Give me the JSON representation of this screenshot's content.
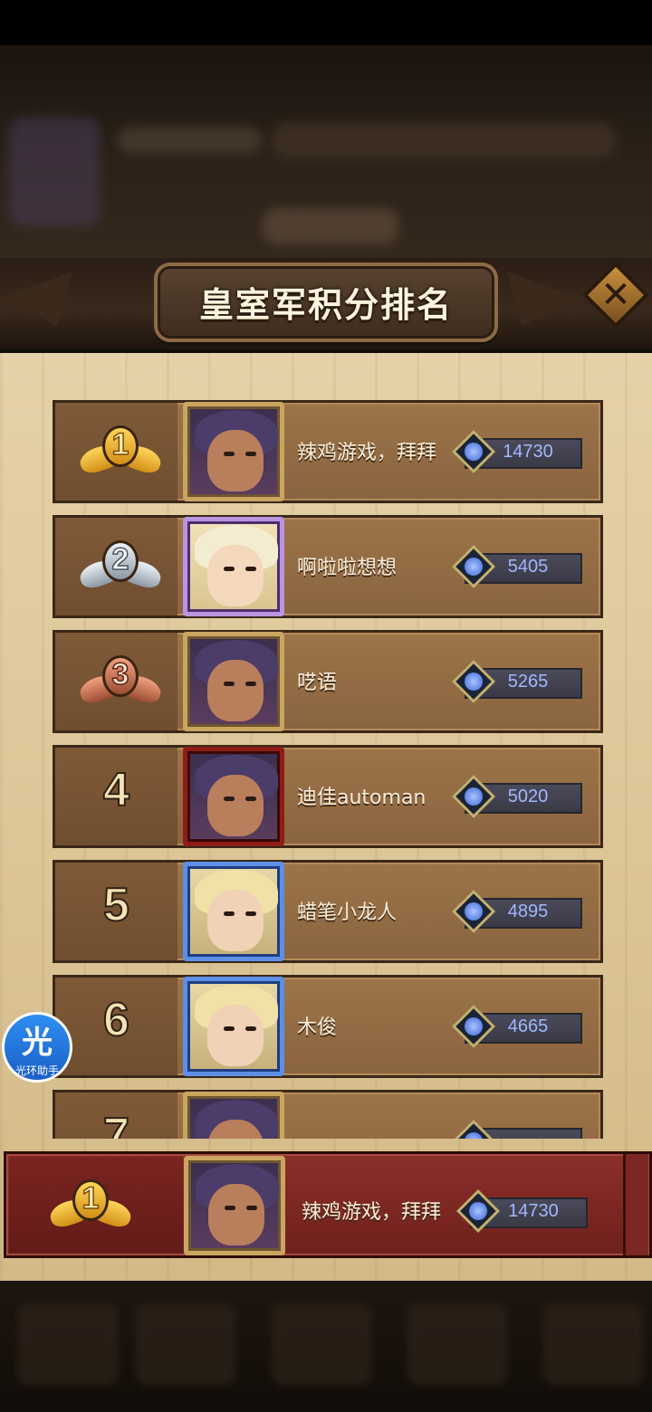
{
  "title": "皇室军积分排名",
  "colors": {
    "panel": "#dcc597",
    "row": "#8a6440",
    "highlight_bar": "#7a2420",
    "score_text": "#9fb8ff"
  },
  "close_icon": "close-x-icon",
  "rankings": [
    {
      "rank": "1",
      "medal": "gold",
      "name": "辣鸡游戏，拜拜",
      "score": "14730",
      "frame": "gold"
    },
    {
      "rank": "2",
      "medal": "silver",
      "name": "啊啦啦想想",
      "score": "5405",
      "frame": "purple"
    },
    {
      "rank": "3",
      "medal": "bronze",
      "name": "呓语",
      "score": "5265",
      "frame": "gold"
    },
    {
      "rank": "4",
      "medal": "",
      "name": "迪佳automan",
      "score": "5020",
      "frame": "red"
    },
    {
      "rank": "5",
      "medal": "",
      "name": "蜡笔小龙人",
      "score": "4895",
      "frame": "blue"
    },
    {
      "rank": "6",
      "medal": "",
      "name": "木俊",
      "score": "4665",
      "frame": "blue"
    },
    {
      "rank": "7",
      "medal": "",
      "name": "",
      "score": "",
      "frame": "gold"
    }
  ],
  "my_rank": {
    "rank": "1",
    "name": "辣鸡游戏，拜拜",
    "score": "14730"
  },
  "helper": {
    "glyph": "光",
    "label": "光环助手"
  }
}
